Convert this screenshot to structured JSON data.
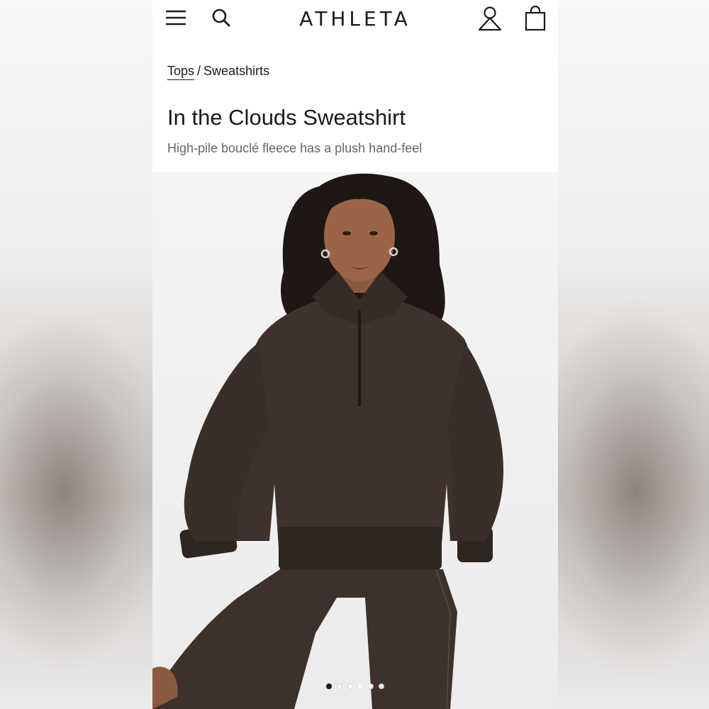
{
  "header": {
    "logo": "ATHLETA",
    "icons": [
      "menu-icon",
      "search-icon",
      "account-icon",
      "shopping-bag-icon"
    ]
  },
  "breadcrumb": {
    "parent": "Tops",
    "separator": "/",
    "current": "Sweatshirts"
  },
  "product": {
    "title": "In the Clouds Sweatshirt",
    "subtitle": "High-pile bouclé fleece has a plush hand-feel",
    "image_alt": "model wearing a dark brown high-pile half-zip sweatshirt and brown leggings"
  },
  "carousel": {
    "total_dots": 5,
    "active_index": 0
  },
  "colors": {
    "text": "#1a1a1a",
    "subtext": "#666666",
    "sweatshirt": "#3f322d",
    "background": "#ffffff"
  }
}
